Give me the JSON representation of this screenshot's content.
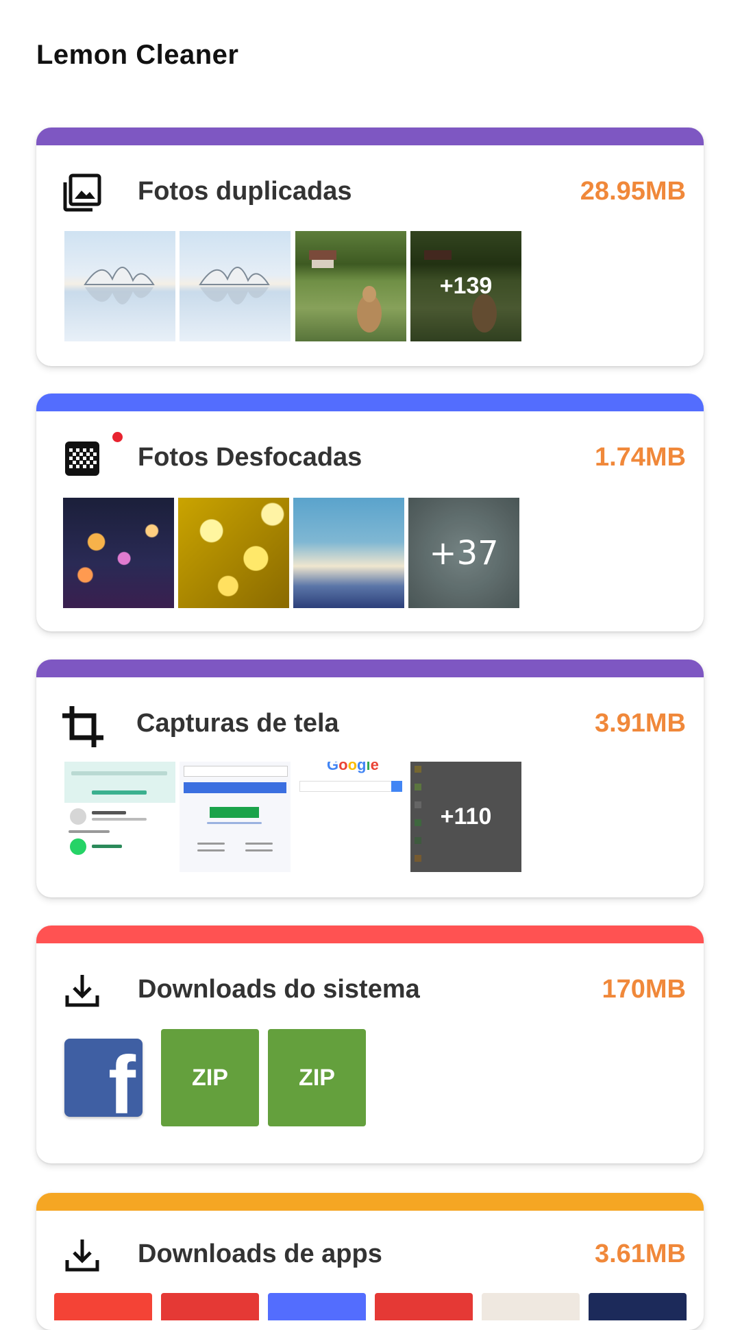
{
  "app": {
    "title": "Lemon Cleaner"
  },
  "cards": [
    {
      "title": "Fotos duplicadas",
      "size": "28.95MB",
      "bar_color": "#7e57c2",
      "icon": "photo-library-icon",
      "more_count": "+139"
    },
    {
      "title": "Fotos Desfocadas",
      "size": "1.74MB",
      "bar_color": "#536dfe",
      "icon": "blur-grid-icon",
      "more_count": "+37"
    },
    {
      "title": "Capturas de tela",
      "size": "3.91MB",
      "bar_color": "#7e57c2",
      "icon": "crop-icon",
      "more_count": "+110"
    },
    {
      "title": "Downloads do sistema",
      "size": "170MB",
      "bar_color": "#ff5252",
      "icon": "download-icon",
      "files": [
        "ZIP",
        "ZIP"
      ]
    },
    {
      "title": "Downloads de apps",
      "size": "3.61MB",
      "bar_color": "#f5a623",
      "icon": "download-icon"
    }
  ],
  "colors": {
    "size_text": "#f0883a",
    "title_text": "#333333",
    "zip_tile": "#64a03d",
    "notification_dot": "#e8232f"
  }
}
